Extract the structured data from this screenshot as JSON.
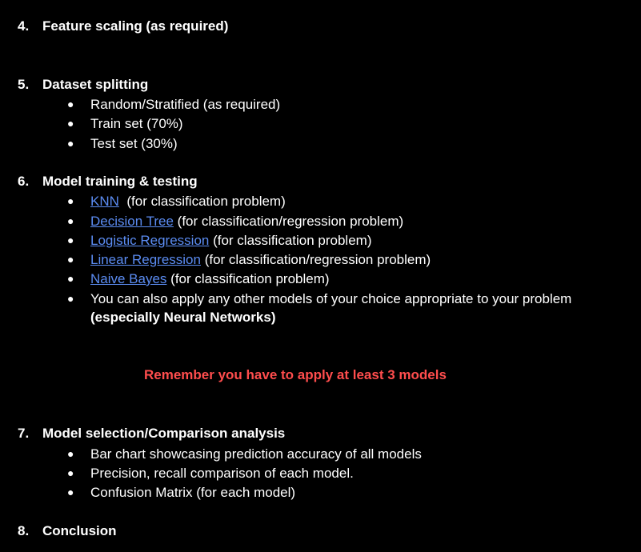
{
  "colors": {
    "background": "#000000",
    "text": "#ffffff",
    "link": "#5b8cf2",
    "highlight": "#ff4d4d"
  },
  "bullet_glyph": "●",
  "sections": {
    "s4": {
      "num": "4.",
      "title": "Feature scaling (as required)"
    },
    "s5": {
      "num": "5.",
      "title": "Dataset splitting",
      "items": [
        "Random/Stratified (as required)",
        "Train set (70%)",
        "Test set (30%)"
      ]
    },
    "s6": {
      "num": "6.",
      "title": "Model training & testing",
      "items": [
        {
          "link": "KNN",
          "text": "  (for classification problem)"
        },
        {
          "link": "Decision Tree",
          "text": " (for classification/regression problem)"
        },
        {
          "link": "Logistic Regression",
          "text": " (for classification problem)"
        },
        {
          "link": "Linear Regression",
          "text": " (for classification/regression problem)"
        },
        {
          "link": "Naive Bayes",
          "text": " (for classification problem)"
        }
      ],
      "other": "You can also apply any other models of your choice appropriate to your problem",
      "other_bold": "(especially Neural Networks)"
    },
    "notice": "Remember you have to apply at least 3 models",
    "s7": {
      "num": "7.",
      "title": "Model selection/Comparison analysis",
      "items": [
        "Bar chart showcasing prediction accuracy of all models",
        "Precision, recall comparison of each model.",
        "Confusion Matrix (for each model)"
      ]
    },
    "s8": {
      "num": "8.",
      "title": "Conclusion"
    }
  }
}
